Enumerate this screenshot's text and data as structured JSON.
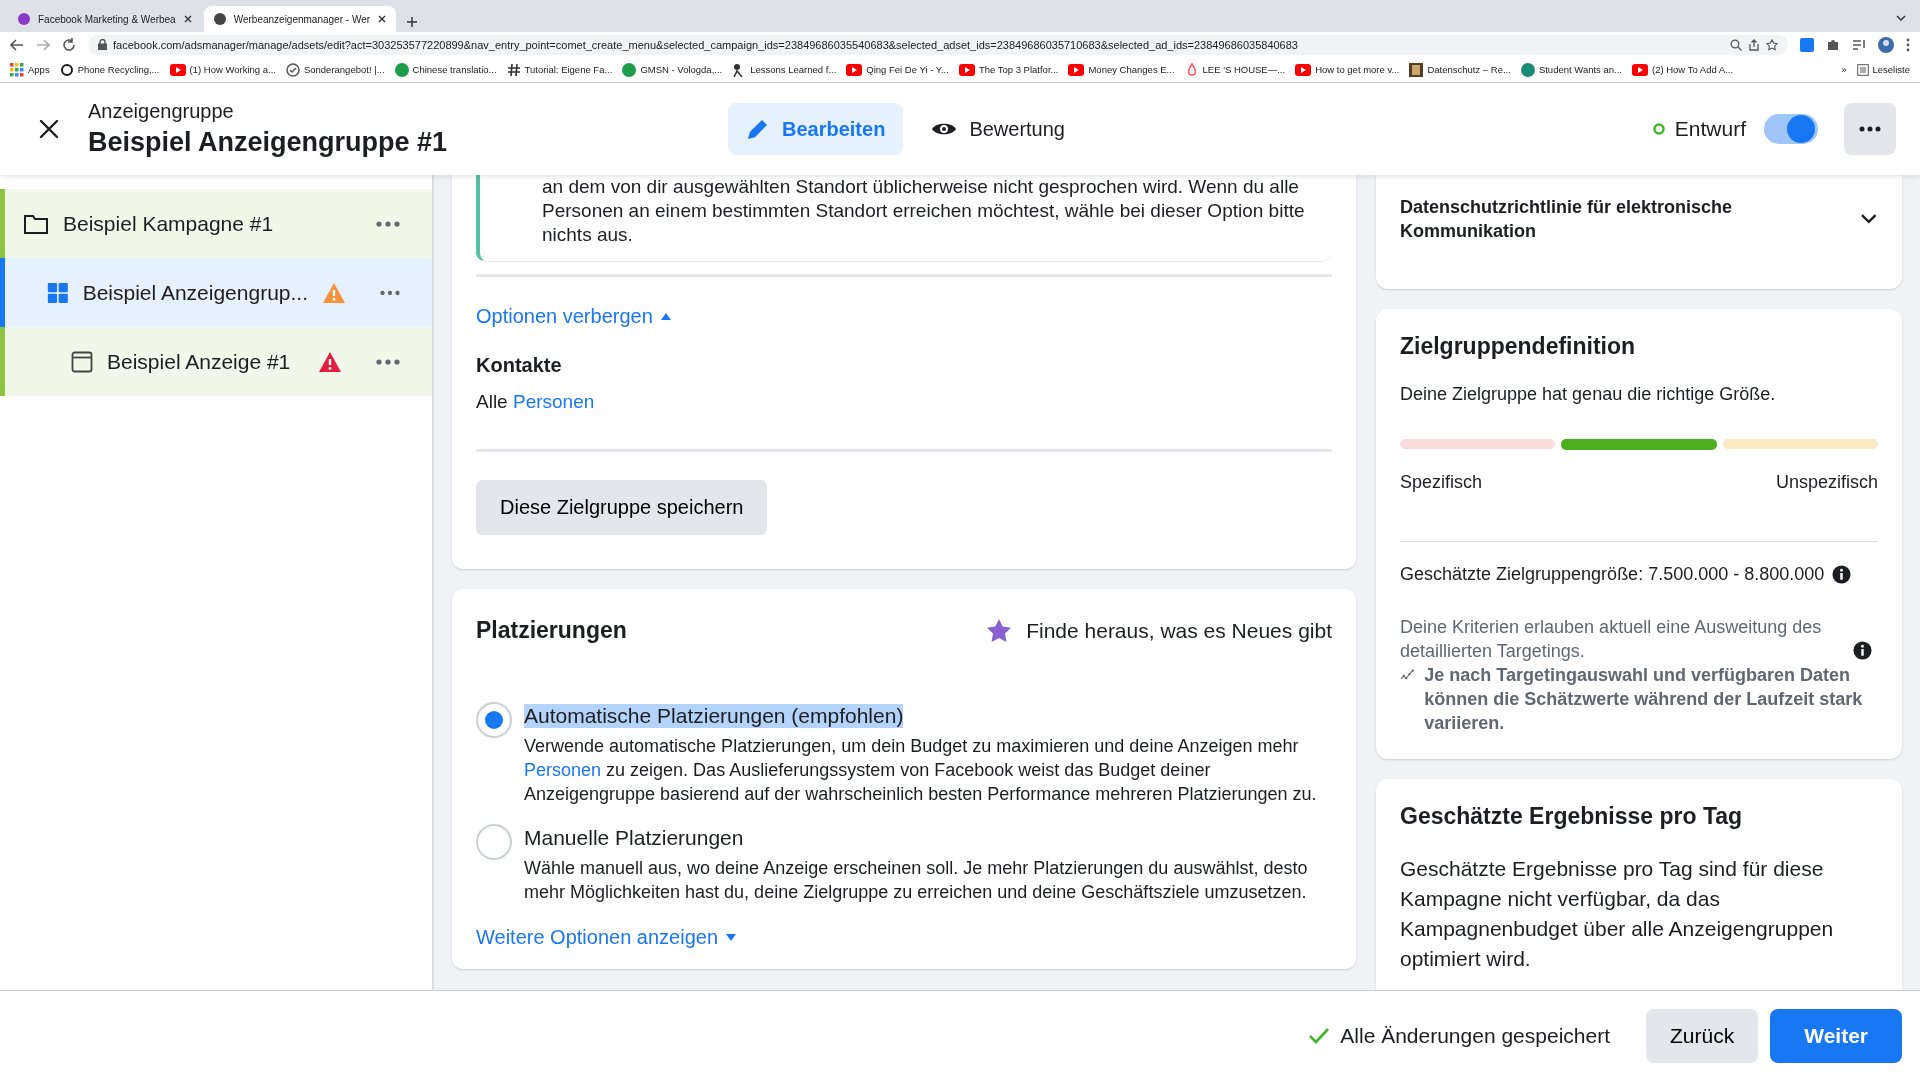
{
  "browser": {
    "tabs": [
      {
        "title": "Facebook Marketing & Werbea",
        "selected": false
      },
      {
        "title": "Werbeanzeigenmanager - Wer",
        "selected": true
      }
    ],
    "url": "facebook.com/adsmanager/manage/adsets/edit?act=303253577220899&nav_entry_point=comet_create_menu&selected_campaign_ids=23849686035540683&selected_adset_ids=23849686035710683&selected_ad_ids=23849686035840683",
    "bookmarks": [
      {
        "label": "Apps",
        "kind": "apps"
      },
      {
        "label": "Phone Recycling,...",
        "kind": "o2"
      },
      {
        "label": "(1) How Working a...",
        "kind": "video"
      },
      {
        "label": "Sonderangebot! |...",
        "kind": "check"
      },
      {
        "label": "Chinese translatio...",
        "kind": "green"
      },
      {
        "label": "Tutorial: Eigene Fa...",
        "kind": "hash"
      },
      {
        "label": "GMSN - Vologda,...",
        "kind": "green"
      },
      {
        "label": "Lessons Learned f...",
        "kind": "person"
      },
      {
        "label": "Qing Fei De Yi - Y...",
        "kind": "video"
      },
      {
        "label": "The Top 3 Platfor...",
        "kind": "video"
      },
      {
        "label": "Money Changes E...",
        "kind": "video"
      },
      {
        "label": "LEE 'S HOUSE—...",
        "kind": "home"
      },
      {
        "label": "How to get more v...",
        "kind": "video"
      },
      {
        "label": "Datenschutz – Re...",
        "kind": "book"
      },
      {
        "label": "Student Wants an...",
        "kind": "teal"
      },
      {
        "label": "(2) How To Add A...",
        "kind": "video"
      }
    ],
    "more_bookmarks": "»",
    "reading_list": "Leseliste"
  },
  "header": {
    "subtitle": "Anzeigengruppe",
    "title": "Beispiel Anzeigengruppe #1",
    "tabs": [
      {
        "label": "Bearbeiten",
        "kind": "edit",
        "selected": true
      },
      {
        "label": "Bewertung",
        "kind": "review",
        "selected": false
      }
    ],
    "status": "Entwurf",
    "toggle_on": true
  },
  "sidebar": {
    "items": [
      {
        "name": "Beispiel Kampagne #1",
        "kind": "campaign",
        "warning": false,
        "error": false,
        "selected": false,
        "children": [
          {
            "name": "Beispiel Anzeigengrup...",
            "kind": "adset",
            "warning": true,
            "error": false,
            "selected": true,
            "children": [
              {
                "name": "Beispiel Anzeige #1",
                "kind": "ad",
                "warning": false,
                "error": true,
                "selected": false
              }
            ]
          }
        ]
      }
    ]
  },
  "audience_card": {
    "note": "an dem von dir ausgewählten Standort üblicherweise nicht gesprochen wird. Wenn du alle Personen an einem bestimmten Standort erreichen möchtest, wähle bei dieser Option bitte nichts aus.",
    "toggle_link": "Optionen verbergen",
    "contacts_label": "Kontakte",
    "contacts_prefix": "Alle",
    "contacts_link": "Personen",
    "save_button": "Diese Zielgruppe speichern"
  },
  "placements": {
    "title": "Platzierungen",
    "whats_new": "Finde heraus, was es Neues gibt",
    "options": [
      {
        "label": "Automatische Platzierungen (empfohlen)",
        "text_highlighted": true,
        "selected": true,
        "description_before": "Verwende automatische Platzierungen, um dein Budget zu maximieren und deine Anzeigen mehr ",
        "description_link": "Personen",
        "description_after": " zu zeigen. Das Auslieferungssystem von Facebook weist das Budget deiner Anzeigengruppe basierend auf der wahrscheinlich besten Performance mehreren Platzierungen zu."
      },
      {
        "label": "Manuelle Platzierungen",
        "text_highlighted": false,
        "selected": false,
        "description_before": "Wähle manuell aus, wo deine Anzeige erscheinen soll. Je mehr Platzierungen du auswählst, desto mehr Möglichkeiten hast du, deine Zielgruppe zu erreichen und deine Geschäftsziele umzusetzen."
      }
    ],
    "more_link": "Weitere Optionen anzeigen"
  },
  "privacy": {
    "title": "Datenschutzrichtlinie für elektronische Kommunikation",
    "expanded": false
  },
  "definition": {
    "title": "Zielgruppendefinition",
    "summary": "Deine Zielgruppe hat genau die richtige Größe.",
    "segments": [
      {
        "color": "#f9dcdc",
        "active": false
      },
      {
        "color": "#4caf1f",
        "active": true
      },
      {
        "color": "#fbe8c4",
        "active": false
      }
    ],
    "left_label": "Spezifisch",
    "right_label": "Unspezifisch",
    "estimate": "Geschätzte Zielgruppengröße: 7.500.000 - 8.800.000",
    "criteria": "Deine Kriterien erlauben aktuell eine Ausweitung des detaillierten Targetings.",
    "disclaimer": "Je nach Targetingauswahl und verfügbaren Daten können die Schätzwerte während der Laufzeit stark variieren."
  },
  "results": {
    "title": "Geschätzte Ergebnisse pro Tag",
    "text": "Geschätzte Ergebnisse pro Tag sind für diese Kampagne nicht verfügbar, da das Kampagnenbudget über alle Anzeigengruppen optimiert wird."
  },
  "footer": {
    "saved": "Alle Änderungen gespeichert",
    "back": "Zurück",
    "next": "Weiter"
  }
}
